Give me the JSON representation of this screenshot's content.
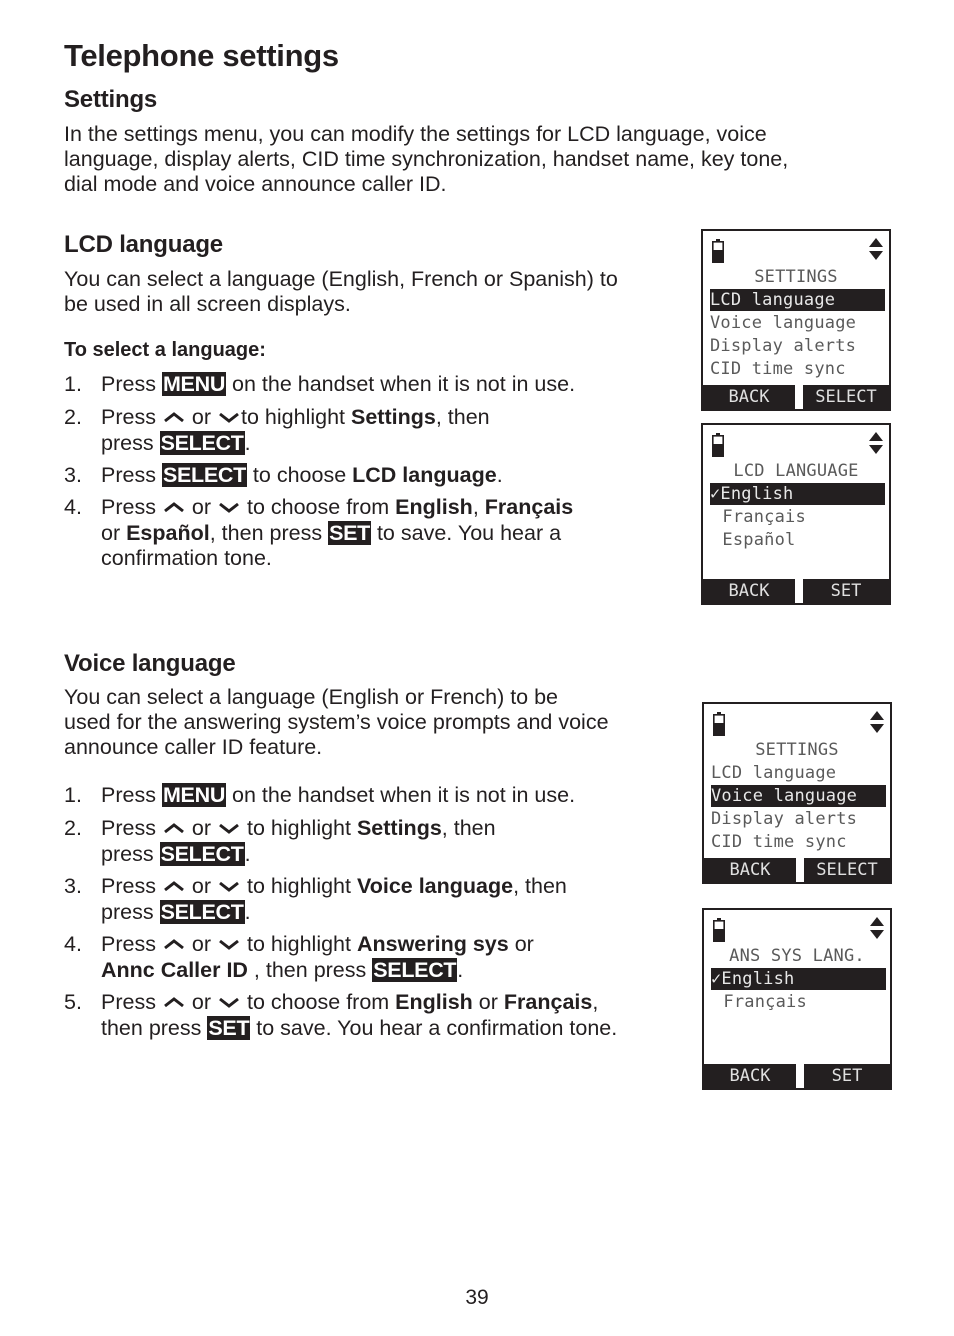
{
  "page": {
    "title": "Telephone settings",
    "page_number": "39"
  },
  "settings_section": {
    "heading": "Settings",
    "intro_lines": [
      "In the settings menu, you can modify the settings for LCD language, voice",
      "language, display alerts, CID time synchronization, handset name, key tone,",
      "dial mode and voice announce caller ID."
    ]
  },
  "lcd_language": {
    "heading": "LCD language",
    "desc_lines": [
      "You can select a language (English, French or Spanish) to",
      "be used in all screen displays."
    ],
    "subheading": "To select a language:",
    "steps": [
      {
        "num": "1.",
        "parts": {
          "a": "Press ",
          "key": "MENU",
          "b": " on the handset when it is not in use."
        }
      },
      {
        "num": "2.",
        "parts": {
          "a": "Press ",
          "or": " or ",
          "b": "to highlight ",
          "bold": "Settings",
          "c": ", then",
          "d": "press ",
          "key": "SELECT",
          "e": "."
        }
      },
      {
        "num": "3.",
        "parts": {
          "a": "Press ",
          "key": "SELECT",
          "b": " to choose ",
          "bold": "LCD language",
          "c": "."
        }
      },
      {
        "num": "4.",
        "parts": {
          "a": "Press ",
          "or": " or ",
          "b": " to choose from ",
          "bold1": "English",
          "c": ", ",
          "bold2": "Français",
          "d": "or ",
          "bold3": "Español",
          "e": ", then press ",
          "key": "SET",
          "f": " to save. You hear a",
          "g": "confirmation tone."
        }
      }
    ],
    "screens": [
      {
        "title": "SETTINGS",
        "items": [
          "LCD language",
          "Voice language",
          "Display alerts",
          "CID time sync"
        ],
        "selected_index": 0,
        "softkey_left": "BACK",
        "softkey_right": "SELECT"
      },
      {
        "title": "LCD LANGUAGE",
        "items": [
          "✓English",
          " Français",
          " Español"
        ],
        "selected_index": 0,
        "softkey_left": "BACK",
        "softkey_right": "SET"
      }
    ]
  },
  "voice_language": {
    "heading": "Voice language",
    "desc_lines": [
      "You can select a language (English or French) to be",
      "used for the answering system’s voice prompts and voice",
      "announce caller ID feature."
    ],
    "steps": [
      {
        "num": "1.",
        "parts": {
          "a": "Press ",
          "key": "MENU",
          "b": " on the handset when it is not in use."
        }
      },
      {
        "num": "2.",
        "parts": {
          "a": "Press ",
          "or": " or ",
          "b": " to highlight ",
          "bold": "Settings",
          "c": ", then",
          "d": "press ",
          "key": "SELECT",
          "e": "."
        }
      },
      {
        "num": "3.",
        "parts": {
          "a": "Press ",
          "or": " or ",
          "b": " to highlight ",
          "bold": "Voice language",
          "c": ", then",
          "d": "press ",
          "key": "SELECT",
          "e": "."
        }
      },
      {
        "num": "4.",
        "parts": {
          "a": "Press ",
          "or": " or ",
          "b": " to highlight ",
          "bold1": "Answering sys",
          "c": " or",
          "bold2": "Annc Caller ID",
          "d": " , then press ",
          "key": "SELECT",
          "e": "."
        }
      },
      {
        "num": "5.",
        "parts": {
          "a": "Press ",
          "or": " or ",
          "b": " to choose from ",
          "bold1": "English",
          "c": " or ",
          "bold2": "Français",
          "d": ",",
          "e": "then press ",
          "key": "SET",
          "f": " to save. You hear a confirmation tone."
        }
      }
    ],
    "screens": [
      {
        "title": "SETTINGS",
        "items": [
          "LCD language",
          "Voice language",
          "Display alerts",
          "CID time sync"
        ],
        "selected_index": 1,
        "softkey_left": "BACK",
        "softkey_right": "SELECT"
      },
      {
        "title": "ANS SYS LANG.",
        "items": [
          "✓English",
          " Français"
        ],
        "selected_index": 0,
        "softkey_left": "BACK",
        "softkey_right": "SET"
      }
    ]
  },
  "icons": {
    "up": "up-arrow-key-icon",
    "down": "down-arrow-key-icon",
    "battery": "battery-icon",
    "scroll": "scroll-arrows-icon"
  }
}
